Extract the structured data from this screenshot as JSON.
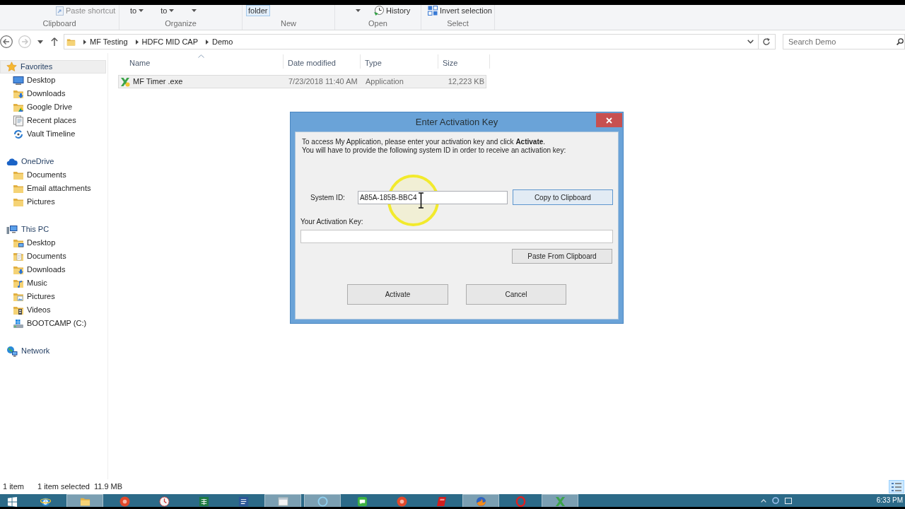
{
  "ribbon": {
    "groups": [
      {
        "label": "Clipboard",
        "commands": [
          {
            "kind": "shortcut",
            "label": "Paste shortcut",
            "highlighted": false,
            "disabled": true
          }
        ]
      },
      {
        "label": "Organize",
        "commands": [
          {
            "kind": "dropdown",
            "label": "to",
            "highlighted": false,
            "disabled": false
          },
          {
            "kind": "dropdown",
            "label": "to",
            "highlighted": false,
            "disabled": false
          },
          {
            "kind": "caret",
            "highlighted": false,
            "disabled": false
          }
        ]
      },
      {
        "label": "New",
        "commands": [
          {
            "kind": "plain",
            "label": "folder",
            "highlighted": true,
            "disabled": false
          }
        ]
      },
      {
        "label": "Open",
        "commands": [
          {
            "kind": "caret",
            "highlighted": false,
            "disabled": false
          },
          {
            "kind": "history",
            "label": "History",
            "highlighted": false,
            "disabled": false
          }
        ]
      },
      {
        "label": "Select",
        "commands": [
          {
            "kind": "invert",
            "label": "Invert selection",
            "highlighted": false,
            "disabled": false
          }
        ]
      }
    ]
  },
  "navigation": {
    "back": {
      "disabled": false
    },
    "forward": {
      "disabled": true
    }
  },
  "address": {
    "path": [
      "MF Testing",
      "HDFC MID CAP",
      "Demo"
    ]
  },
  "search": {
    "placeholder": "Search Demo"
  },
  "sidebar": {
    "groups": [
      {
        "label": "Favorites",
        "kind": "star",
        "selected": true,
        "children": [
          {
            "label": "Desktop",
            "kind": "monitor",
            "selected": false
          },
          {
            "label": "Downloads",
            "kind": "download-folder",
            "selected": false
          },
          {
            "label": "Google Drive",
            "kind": "triangle-folder",
            "selected": false
          },
          {
            "label": "Recent places",
            "kind": "pages",
            "selected": false
          },
          {
            "label": "Vault Timeline",
            "kind": "circular-arrows",
            "selected": false
          }
        ]
      },
      {
        "label": "OneDrive",
        "kind": "cloud",
        "selected": false,
        "children": [
          {
            "label": "Documents",
            "kind": "folder",
            "selected": false
          },
          {
            "label": "Email attachments",
            "kind": "folder",
            "selected": false
          },
          {
            "label": "Pictures",
            "kind": "folder",
            "selected": false
          }
        ]
      },
      {
        "label": "This PC",
        "kind": "computer",
        "selected": false,
        "children": [
          {
            "label": "Desktop",
            "kind": "monitor-folder",
            "selected": false
          },
          {
            "label": "Documents",
            "kind": "document-folder",
            "selected": false
          },
          {
            "label": "Downloads",
            "kind": "download-folder",
            "selected": false
          },
          {
            "label": "Music",
            "kind": "music-folder",
            "selected": false
          },
          {
            "label": "Pictures",
            "kind": "picture-folder",
            "selected": false
          },
          {
            "label": "Videos",
            "kind": "film-folder",
            "selected": false
          },
          {
            "label": "BOOTCAMP (C:)",
            "kind": "drive",
            "selected": false
          }
        ]
      },
      {
        "label": "Network",
        "kind": "network",
        "selected": false
      }
    ]
  },
  "file_list": {
    "columns": [
      {
        "label": "Name",
        "sorted": true
      },
      {
        "label": "Date modified",
        "sorted": false
      },
      {
        "label": "Type",
        "sorted": false
      },
      {
        "label": "Size",
        "sorted": false
      }
    ],
    "rows": [
      {
        "name": "MF Timer .exe",
        "date_modified": "7/23/2018 11:40 AM",
        "type": "Application",
        "size": "12,223 KB",
        "selected": true
      }
    ]
  },
  "status_bar": {
    "item_count": "1 item",
    "selection": "1 item selected",
    "selection_size": "11.9 MB",
    "views": [
      {
        "kind": "details",
        "selected": true
      }
    ]
  },
  "dialog": {
    "title": "Enter Activation Key",
    "intro": "To access My Application, please enter your activation key and click **Activate**.",
    "instruction": "You will have to provide the following system ID in order to receive an activation key:",
    "system_id": {
      "label": "System ID:",
      "value": "A85A-185B-BBC4"
    },
    "copy_button": {
      "label": "Copy to Clipboard",
      "highlighted": true
    },
    "activation_key": {
      "label": "Your Activation Key:"
    },
    "paste_button": {
      "label": "Paste From Clipboard",
      "highlighted": false
    },
    "buttons": [
      {
        "label": "Activate",
        "highlighted": false
      },
      {
        "label": "Cancel",
        "highlighted": false
      }
    ]
  },
  "taskbar": {
    "apps": [
      {
        "kind": "start",
        "active": false
      },
      {
        "kind": "globe-e",
        "active": false
      },
      {
        "kind": "folder",
        "active": true
      },
      {
        "kind": "round",
        "active": false
      },
      {
        "kind": "clock",
        "active": false
      },
      {
        "kind": "sheet",
        "active": false
      },
      {
        "kind": "doc",
        "active": false
      },
      {
        "kind": "window",
        "active": true
      },
      {
        "kind": "ring",
        "active": true
      },
      {
        "kind": "chat",
        "active": false
      },
      {
        "kind": "round",
        "active": false
      },
      {
        "kind": "logo",
        "active": false
      },
      {
        "kind": "flame-globe",
        "active": true
      },
      {
        "kind": "ring-red",
        "active": false
      },
      {
        "kind": "x-app",
        "active": true
      }
    ],
    "clock": "6:33 PM"
  }
}
